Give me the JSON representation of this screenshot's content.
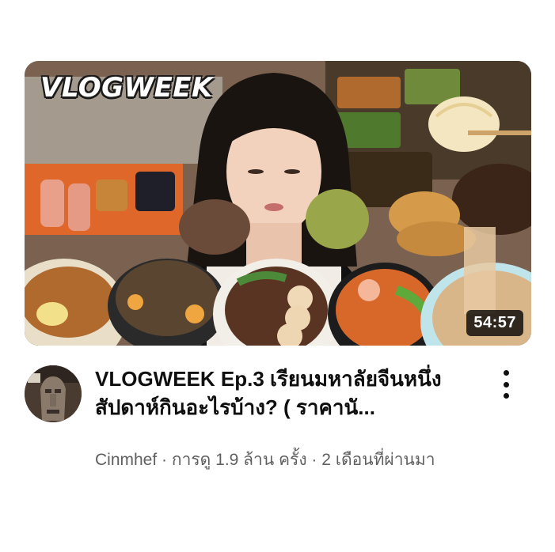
{
  "video": {
    "thumbnail_brand_text": "VLOGWEEK",
    "duration": "54:57",
    "title": "VLOGWEEK Ep.3 เรียนมหาลัยจีนหนึ่งสัปดาห์กินอะไรบ้าง? ( ราคานั...",
    "channel": "Cinmhef",
    "views": "การดู 1.9 ล้าน ครั้ง",
    "age": "2 เดือนที่ผ่านมา",
    "separator": " · "
  },
  "icons": {
    "more_menu": "more-vert-icon"
  }
}
